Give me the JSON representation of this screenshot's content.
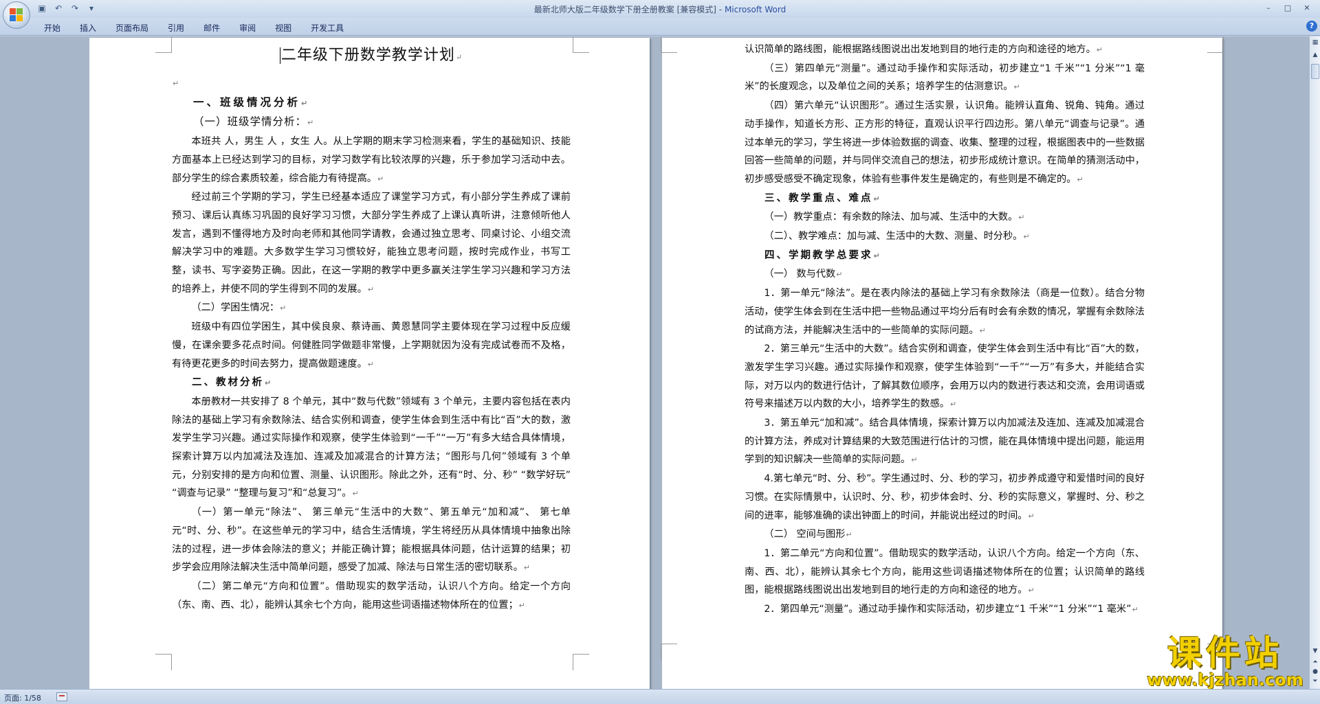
{
  "window": {
    "title": "最新北师大版二年级数学下册全册教案 [兼容模式]",
    "app_name": "Microsoft Word",
    "minimize": "–",
    "maximize": "□",
    "close": "✕"
  },
  "quick_access": {
    "save": "▣",
    "undo": "↶",
    "redo": "↷",
    "customize": "▾"
  },
  "ribbon": {
    "tabs": [
      "开始",
      "插入",
      "页面布局",
      "引用",
      "邮件",
      "审阅",
      "视图",
      "开发工具"
    ],
    "help": "?"
  },
  "left_page": {
    "title": "二年级下册数学教学计划",
    "paragraphs": [
      {
        "cls": "noind",
        "text": ""
      },
      {
        "cls": "h2",
        "text": "一、班级情况分析"
      },
      {
        "cls": "h3",
        "text": "（一）班级学情分析："
      },
      {
        "cls": "",
        "text": "本班共    人，男生   人 ，女生    人。从上学期的期末学习检测来看，学生的基础知识、技能方面基本上已经达到学习的目标，对学习数学有比较浓厚的兴趣，乐于参加学习活动中去。部分学生的综合素质较差，综合能力有待提高。"
      },
      {
        "cls": "",
        "text": "经过前三个学期的学习，学生已经基本适应了课堂学习方式，有小部分学生养成了课前预习、课后认真练习巩固的良好学习习惯，大部分学生养成了上课认真听讲，注意倾听他人发言，遇到不懂得地方及时向老师和其他同学请教，会通过独立思考、同桌讨论、小组交流解决学习中的难题。大多数学生学习习惯较好，能独立思考问题，按时完成作业，书写工整，读书、写字姿势正确。因此，在这一学期的教学中更多赢关注学生学习兴趣和学习方法的培养上，并使不同的学生得到不同的发展。"
      },
      {
        "cls": "",
        "text": "（二）学困生情况："
      },
      {
        "cls": "",
        "text": "班级中有四位学困生，其中侯良泉、蔡诗画、黄恩慧同学主要体现在学习过程中反应缓慢，在课余要多花点时间。何健胜同学做题非常慢，上学期就因为没有完成试卷而不及格，有待更花更多的时间去努力，提高做题速度。"
      },
      {
        "cls": "h2s",
        "text": "二、教材分析"
      },
      {
        "cls": "",
        "text": "本册教材一共安排了 8 个单元，其中“数与代数”领域有 3 个单元，主要内容包括在表内除法的基础上学习有余数除法、结合实例和调查，使学生体会到生活中有比“百”大的数，激发学生学习兴趣。通过实际操作和观察，使学生体验到“一千”“一万”有多大结合具体情境，探索计算万以内加减法及连加、连减及加减混合的计算方法；“图形与几何”领域有 3 个单元，分别安排的是方向和位置、测量、认识图形。除此之外，还有“时、分、秒” “数学好玩” “调查与记录” “整理与复习”和“总复习”。"
      },
      {
        "cls": "",
        "text": "（一）第一单元“除法”、 第三单元“生活中的大数”、第五单元“加和减”、 第七单元“时、分、秒”。在这些单元的学习中，结合生活情境，学生将经历从具体情境中抽象出除法的过程，进一步体会除法的意义；并能正确计算；能根据具体问题，估计运算的结果；初步学会应用除法解决生活中简单问题，感受了加减、除法与日常生活的密切联系。"
      },
      {
        "cls": "",
        "text": "（二）第二单元“方向和位置”。借助现实的数学活动，认识八个方向。给定一个方向（东、南、西、北），能辨认其余七个方向，能用这些词语描述物体所在的位置；"
      }
    ]
  },
  "right_page": {
    "paragraphs": [
      {
        "cls": "noind",
        "text": "认识简单的路线图，能根据路线图说出出发地到目的地行走的方向和途径的地方。"
      },
      {
        "cls": "",
        "text": "（三）第四单元“测量”。通过动手操作和实际活动，初步建立“1 千米”“1 分米”“1 毫米”的长度观念，以及单位之间的关系；培养学生的估测意识。"
      },
      {
        "cls": "",
        "text": "（四）第六单元“认识图形”。通过生活实景，认识角。能辨认直角、锐角、钝角。通过动手操作，知道长方形、正方形的特征，直观认识平行四边形。第八单元“调查与记录”。通过本单元的学习，学生将进一步体验数据的调查、收集、整理的过程，根据图表中的一些数据回答一些简单的问题，并与同伴交流自己的想法，初步形成统计意识。在简单的猜测活动中，初步感受感受不确定现象，体验有些事件发生是确定的，有些则是不确定的。"
      },
      {
        "cls": "h2s",
        "text": "三、教学重点、难点"
      },
      {
        "cls": "",
        "text": "（一）教学重点：有余数的除法、加与减、生活中的大数。"
      },
      {
        "cls": "",
        "text": "（二）、教学难点：加与减、生活中的大数、测量、时分秒。"
      },
      {
        "cls": "h2s",
        "text": "四、学期教学总要求"
      },
      {
        "cls": "",
        "text": "（一） 数与代数"
      },
      {
        "cls": "",
        "text": "1．第一单元“除法”。是在表内除法的基础上学习有余数除法（商是一位数）。结合分物活动，使学生体会到在生活中把一些物品通过平均分后有时会有余数的情况，掌握有余数除法的试商方法，并能解决生活中的一些简单的实际问题。"
      },
      {
        "cls": "",
        "text": "2．第三单元“生活中的大数”。结合实例和调查，使学生体会到生活中有比“百”大的数，激发学生学习兴趣。通过实际操作和观察，使学生体验到“一千”“一万”有多大，并能结合实际，对万以内的数进行估计，了解其数位顺序，会用万以内的数进行表达和交流，会用词语或符号来描述万以内数的大小，培养学生的数感。"
      },
      {
        "cls": "",
        "text": "3．第五单元“加和减”。结合具体情境，探索计算万以内加减法及连加、连减及加减混合的计算方法，养成对计算结果的大致范围进行估计的习惯，能在具体情境中提出问题，能运用学到的知识解决一些简单的实际问题。"
      },
      {
        "cls": "",
        "text": "4.第七单元“时、分、秒”。学生通过时、分、秒的学习，初步养成遵守和爱惜时间的良好习惯。在实际情景中，认识时、分、秒，初步体会时、分、秒的实际意义，掌握时、分、秒之间的进率，能够准确的读出钟面上的时间，并能说出经过的时间。"
      },
      {
        "cls": "",
        "text": "（二） 空间与图形"
      },
      {
        "cls": "",
        "text": "1．第二单元“方向和位置”。借助现实的数学活动，认识八个方向。给定一个方向（东、南、西、北），能辨认其余七个方向，能用这些词语描述物体所在的位置；认识简单的路线图，能根据路线图说出出发地到目的地行走的方向和途径的地方。"
      },
      {
        "cls": "",
        "text": "2．第四单元“测量”。通过动手操作和实际活动，初步建立“1 千米”“1 分米”“1 毫米”"
      }
    ]
  },
  "status": {
    "page": "页面: 1/58"
  },
  "watermark": {
    "main": "课件站",
    "url": "www.kjzhan.com"
  },
  "colors": {
    "accent": "#2a4fa0",
    "workspace": "#a8b6c9",
    "watermark": "#f2d000"
  }
}
